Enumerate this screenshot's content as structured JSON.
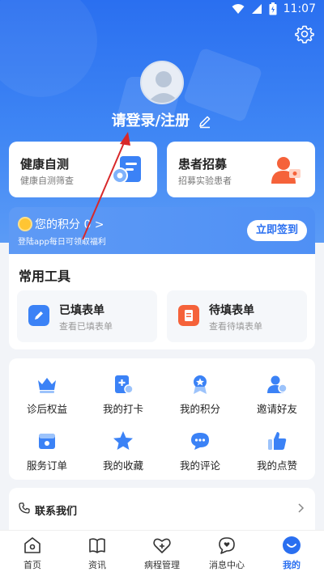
{
  "status_bar": {
    "time": "11:07"
  },
  "profile": {
    "login_text": "请登录/注册"
  },
  "features": [
    {
      "title": "健康自测",
      "subtitle": "健康自测筛查"
    },
    {
      "title": "患者招募",
      "subtitle": "招募实验患者"
    }
  ],
  "points": {
    "title": "您的积分 0 >",
    "subtitle": "登陆app每日可领取福利",
    "checkin_label": "立即签到"
  },
  "tools": {
    "heading": "常用工具",
    "items": [
      {
        "title": "已填表单",
        "subtitle": "查看已填表单"
      },
      {
        "title": "待填表单",
        "subtitle": "查看待填表单"
      }
    ]
  },
  "grid_items": [
    {
      "label": "诊后权益",
      "icon": "crown-icon"
    },
    {
      "label": "我的打卡",
      "icon": "checkin-icon"
    },
    {
      "label": "我的积分",
      "icon": "medal-icon"
    },
    {
      "label": "邀请好友",
      "icon": "invite-icon"
    },
    {
      "label": "服务订单",
      "icon": "order-icon"
    },
    {
      "label": "我的收藏",
      "icon": "star-icon"
    },
    {
      "label": "我的评论",
      "icon": "comment-icon"
    },
    {
      "label": "我的点赞",
      "icon": "thumbs-up-icon"
    }
  ],
  "contact": {
    "label": "联系我们"
  },
  "tabs": [
    {
      "label": "首页",
      "icon": "home-icon"
    },
    {
      "label": "资讯",
      "icon": "book-icon"
    },
    {
      "label": "病程管理",
      "icon": "heart-plus-icon"
    },
    {
      "label": "消息中心",
      "icon": "message-heart-icon"
    },
    {
      "label": "我的",
      "icon": "smile-icon",
      "active": true
    }
  ],
  "colors": {
    "primary": "#2a6ff0",
    "orange": "#f5623a",
    "accent_blue": "#3b82f6"
  }
}
